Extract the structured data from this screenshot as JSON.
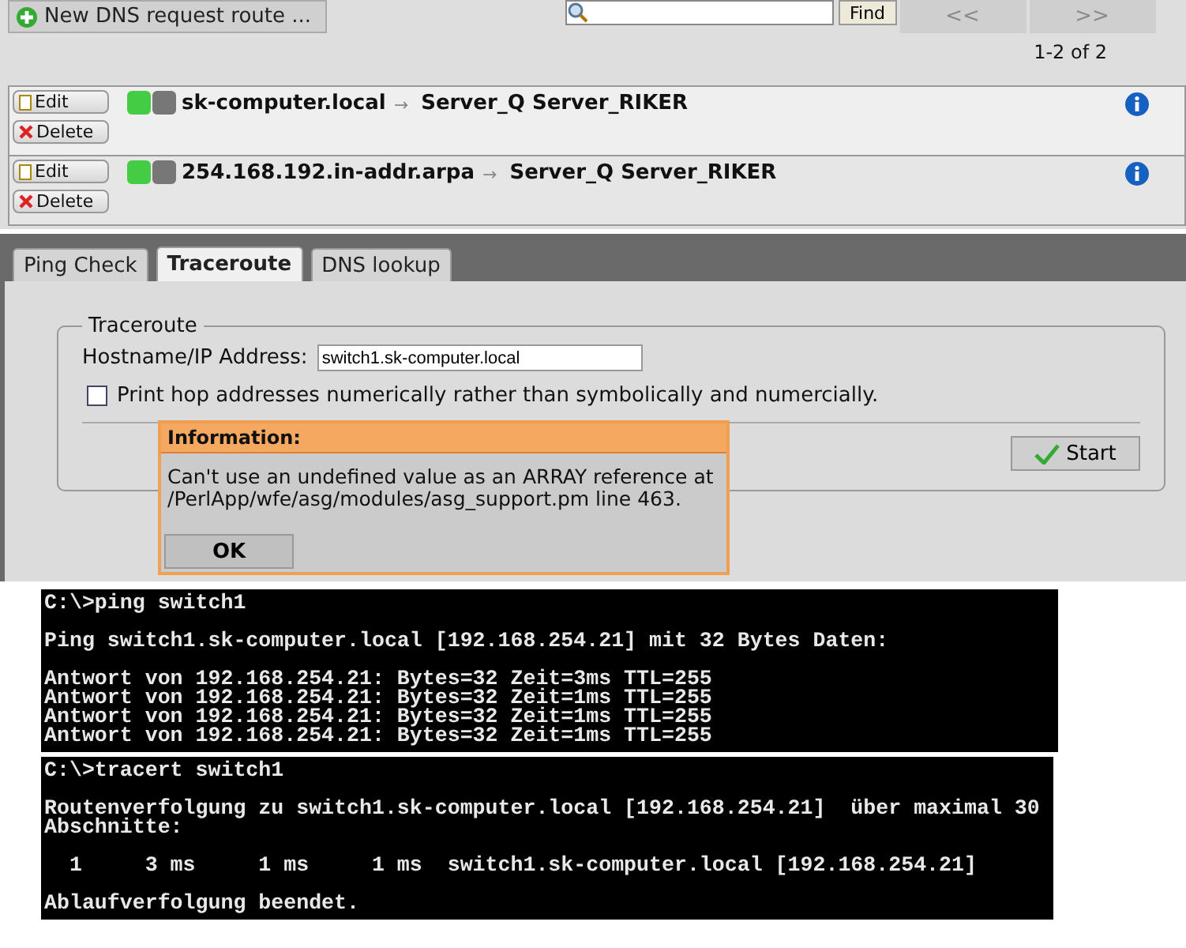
{
  "toolbar": {
    "new_button": "New DNS request route ...",
    "find_button": "Find",
    "pager": [
      {
        "label": "<<",
        "disabled": true
      },
      {
        "label": ">>",
        "disabled": true
      }
    ],
    "count": "1-2 of 2"
  },
  "routes": [
    {
      "edit": "Edit",
      "delete": "Delete",
      "enabled": true,
      "domain": "sk-computer.local",
      "arrow": "→",
      "servers": "Server_Q Server_RIKER"
    },
    {
      "edit": "Edit",
      "delete": "Delete",
      "enabled": true,
      "domain": "254.168.192.in-addr.arpa",
      "arrow": "→",
      "servers": "Server_Q Server_RIKER"
    }
  ],
  "tabs": [
    {
      "label": "Ping Check",
      "selected": false
    },
    {
      "label": "Traceroute",
      "selected": true
    },
    {
      "label": "DNS lookup",
      "selected": false
    }
  ],
  "traceroute": {
    "legend": "Traceroute",
    "host_label": "Hostname/IP Address:",
    "host_value": "switch1.sk-computer.local",
    "checkbox": {
      "label": "Print hop addresses numerically rather than symbolically and numercially.",
      "checked": false
    },
    "start_button": "Start"
  },
  "dialog": {
    "title": "Information:",
    "message": [
      "Can't use an undefined value as an ARRAY reference at",
      "/PerlApp/wfe/asg/modules/asg_support.pm line 463."
    ],
    "ok": "OK"
  },
  "consoles": [
    {
      "blocks": [
        [
          "C:\\>ping switch1"
        ],
        [
          "Ping switch1.sk-computer.local [192.168.254.21] mit 32 Bytes Daten:"
        ],
        [
          "Antwort von 192.168.254.21: Bytes=32 Zeit=3ms TTL=255",
          "Antwort von 192.168.254.21: Bytes=32 Zeit=1ms TTL=255",
          "Antwort von 192.168.254.21: Bytes=32 Zeit=1ms TTL=255",
          "Antwort von 192.168.254.21: Bytes=32 Zeit=1ms TTL=255"
        ]
      ]
    },
    {
      "blocks": [
        [
          "C:\\>tracert switch1"
        ],
        [
          "Routenverfolgung zu switch1.sk-computer.local [192.168.254.21]  über maximal 30",
          "Abschnitte:"
        ],
        [
          "  1     3 ms     1 ms     1 ms  switch1.sk-computer.local [192.168.254.21]"
        ],
        [
          "Ablaufverfolgung beendet."
        ]
      ]
    }
  ]
}
